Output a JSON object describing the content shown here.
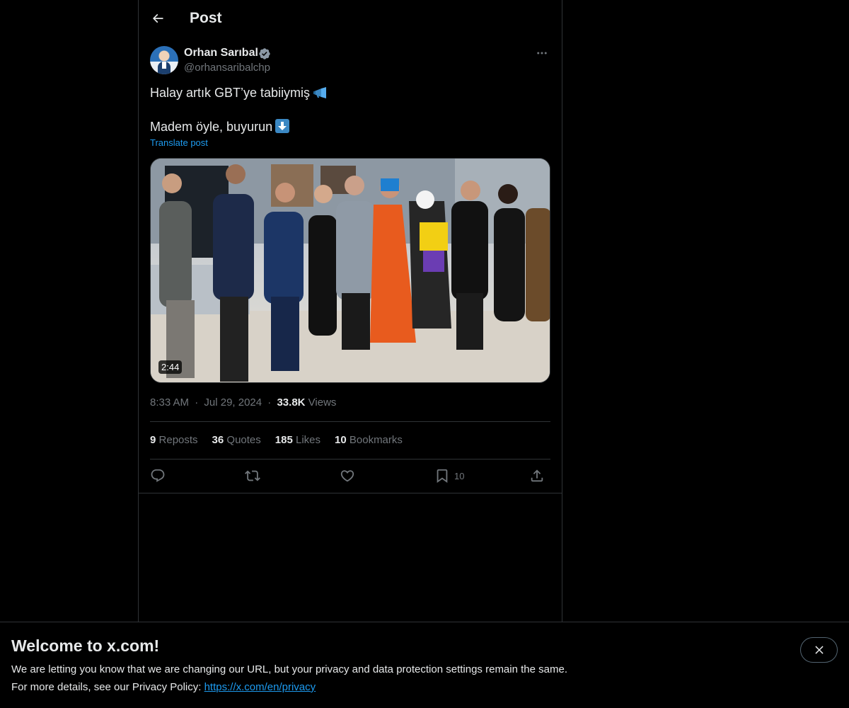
{
  "header": {
    "title": "Post",
    "back_icon": "arrow-left-icon"
  },
  "author": {
    "display_name": "Orhan Sarıbal",
    "handle": "@orhansaribalchp",
    "verified": true,
    "verified_color": "#8b98a5"
  },
  "post": {
    "line1": "Halay artık GBT’ye tabiiymiş",
    "line1_emoji": "megaphone-icon",
    "line2": "Madem öyle, buyurun",
    "line2_emoji": "down-arrow-icon",
    "translate_label": "Translate post",
    "video_duration": "2:44"
  },
  "meta": {
    "time": "8:33 AM",
    "separator": "·",
    "date": "Jul 29, 2024",
    "views_count": "33.8K",
    "views_label": "Views"
  },
  "stats": {
    "reposts_count": "9",
    "reposts_label": "Reposts",
    "quotes_count": "36",
    "quotes_label": "Quotes",
    "likes_count": "185",
    "likes_label": "Likes",
    "bookmarks_count": "10",
    "bookmarks_label": "Bookmarks"
  },
  "actions": {
    "reply_icon": "reply-icon",
    "repost_icon": "repost-icon",
    "like_icon": "heart-icon",
    "bookmark_icon": "bookmark-icon",
    "bookmark_count": "10",
    "share_icon": "share-icon"
  },
  "banner": {
    "title": "Welcome to x.com!",
    "line1": "We are letting you know that we are changing our URL, but your privacy and data protection settings remain the same.",
    "line2_prefix": "For more details, see our Privacy Policy: ",
    "link": "https://x.com/en/privacy",
    "close_icon": "close-icon"
  },
  "colors": {
    "accent": "#1d9bf0",
    "muted": "#71767b",
    "text": "#e7e9ea",
    "border": "#2f3336"
  }
}
